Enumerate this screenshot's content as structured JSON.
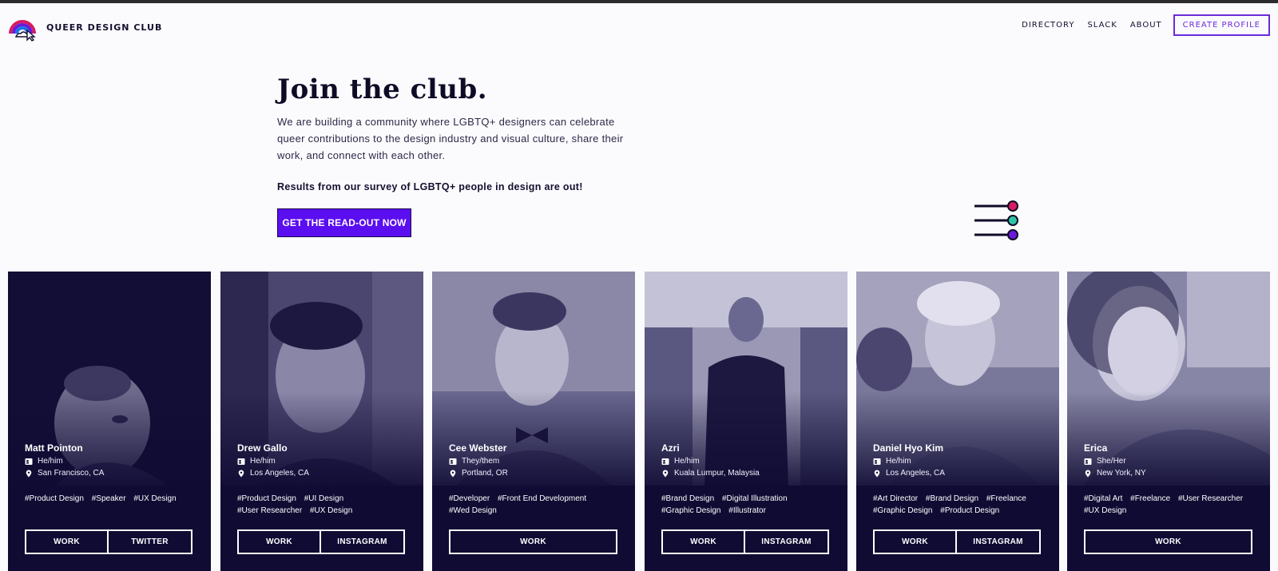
{
  "brand": {
    "name": "QUEER DESIGN CLUB"
  },
  "nav": {
    "directory": "DIRECTORY",
    "slack": "SLACK",
    "about": "ABOUT",
    "create": "CREATE PROFILE"
  },
  "hero": {
    "title": "Join the club.",
    "description": "We are building a community where LGBTQ+ designers can celebrate queer contributions to the design industry and visual culture, share their work, and connect with each other.",
    "survey": "Results from our survey of LGBTQ+ people in design are out!",
    "cta": "GET THE READ-OUT NOW"
  },
  "colors": {
    "accent": "#5b0ef0",
    "card_bg": "#0f0b33",
    "pink": "#d81b60",
    "teal": "#2ec4a6",
    "purple": "#6a1bd9"
  },
  "profiles": [
    {
      "name": "Matt Pointon",
      "pronouns": "He/him",
      "location": "San Francisco, CA",
      "tags": [
        "#Product Design",
        "#Speaker",
        "#UX Design"
      ],
      "buttons": [
        "WORK",
        "TWITTER"
      ]
    },
    {
      "name": "Drew Gallo",
      "pronouns": "He/him",
      "location": "Los Angeles, CA",
      "tags": [
        "#Product Design",
        "#UI Design",
        "#User Researcher",
        "#UX Design"
      ],
      "buttons": [
        "WORK",
        "INSTAGRAM"
      ]
    },
    {
      "name": "Cee Webster",
      "pronouns": "They/them",
      "location": "Portland, OR",
      "tags": [
        "#Developer",
        "#Front End Development",
        "#Wed Design"
      ],
      "buttons": [
        "WORK"
      ]
    },
    {
      "name": "Azri",
      "pronouns": "He/him",
      "location": "Kuala Lumpur, Malaysia",
      "tags": [
        "#Brand Design",
        "#Digital Illustration",
        "#Graphic Design",
        "#Illustrator"
      ],
      "buttons": [
        "WORK",
        "INSTAGRAM"
      ]
    },
    {
      "name": "Daniel Hyo Kim",
      "pronouns": "He/him",
      "location": "Los Angeles, CA",
      "tags": [
        "#Art Director",
        "#Brand Design",
        "#Freelance",
        "#Graphic Design",
        "#Product Design"
      ],
      "buttons": [
        "WORK",
        "INSTAGRAM"
      ]
    },
    {
      "name": "Erica",
      "pronouns": "She/Her",
      "location": "New York, NY",
      "tags": [
        "#Digital Art",
        "#Freelance",
        "#User Researcher",
        "#UX Design"
      ],
      "buttons": [
        "WORK"
      ]
    }
  ]
}
